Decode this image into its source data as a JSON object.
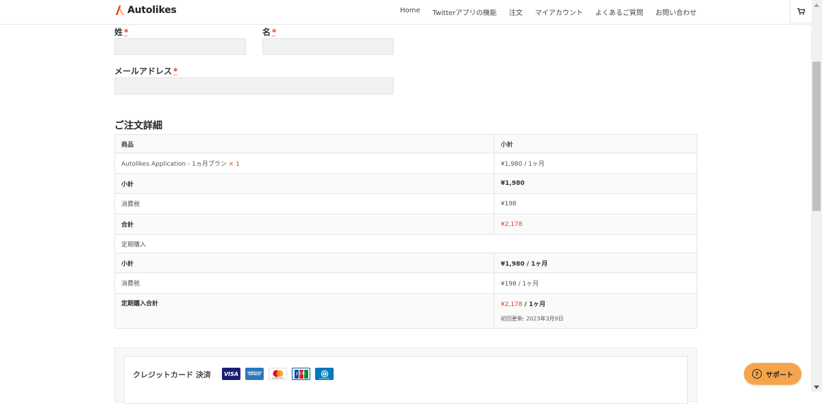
{
  "header": {
    "logo_text": "Autolikes",
    "nav": [
      "Home",
      "Twitterアプリの機能",
      "注文",
      "マイアカウント",
      "よくあるご質問",
      "お問い合わせ"
    ]
  },
  "form": {
    "last_name_label": "姓",
    "first_name_label": "名",
    "email_label": "メールアドレス",
    "required_mark": "*"
  },
  "order": {
    "title": "ご注文詳細",
    "head_product": "商品",
    "head_subtotal": "小計",
    "item_name": "Autolikes Application - 1ヵ月プラン",
    "item_qty": "× 1",
    "item_price": "¥1,980 / 1ヶ月",
    "subtotal_label": "小計",
    "subtotal_value": "¥1,980",
    "tax_label": "消費税",
    "tax_value": "¥198",
    "total_label": "合計",
    "total_value": "¥2,178",
    "recurring_heading": "定期購入",
    "rec_subtotal_label": "小計",
    "rec_subtotal_value": "¥1,980 / 1ヶ月",
    "rec_tax_label": "消費税",
    "rec_tax_value": "¥198 / 1ヶ月",
    "rec_total_label": "定期購入合計",
    "rec_total_amount": "¥2,178",
    "rec_total_period": " / 1ヶ月",
    "renewal_text": "初回更新: 2023年3月9日"
  },
  "payment": {
    "label": "クレジットカード 決済",
    "cards": [
      "VISA",
      "AMERICAN EXPRESS",
      "mastercard",
      "JCB",
      "Diners Club"
    ]
  },
  "support": {
    "label": "サポート"
  },
  "colors": {
    "accent": "#e2401c",
    "support_bg": "#f6a44c",
    "visa": "#1a1f71",
    "amex": "#2e77bc",
    "jcb": "#0b4ea2"
  }
}
